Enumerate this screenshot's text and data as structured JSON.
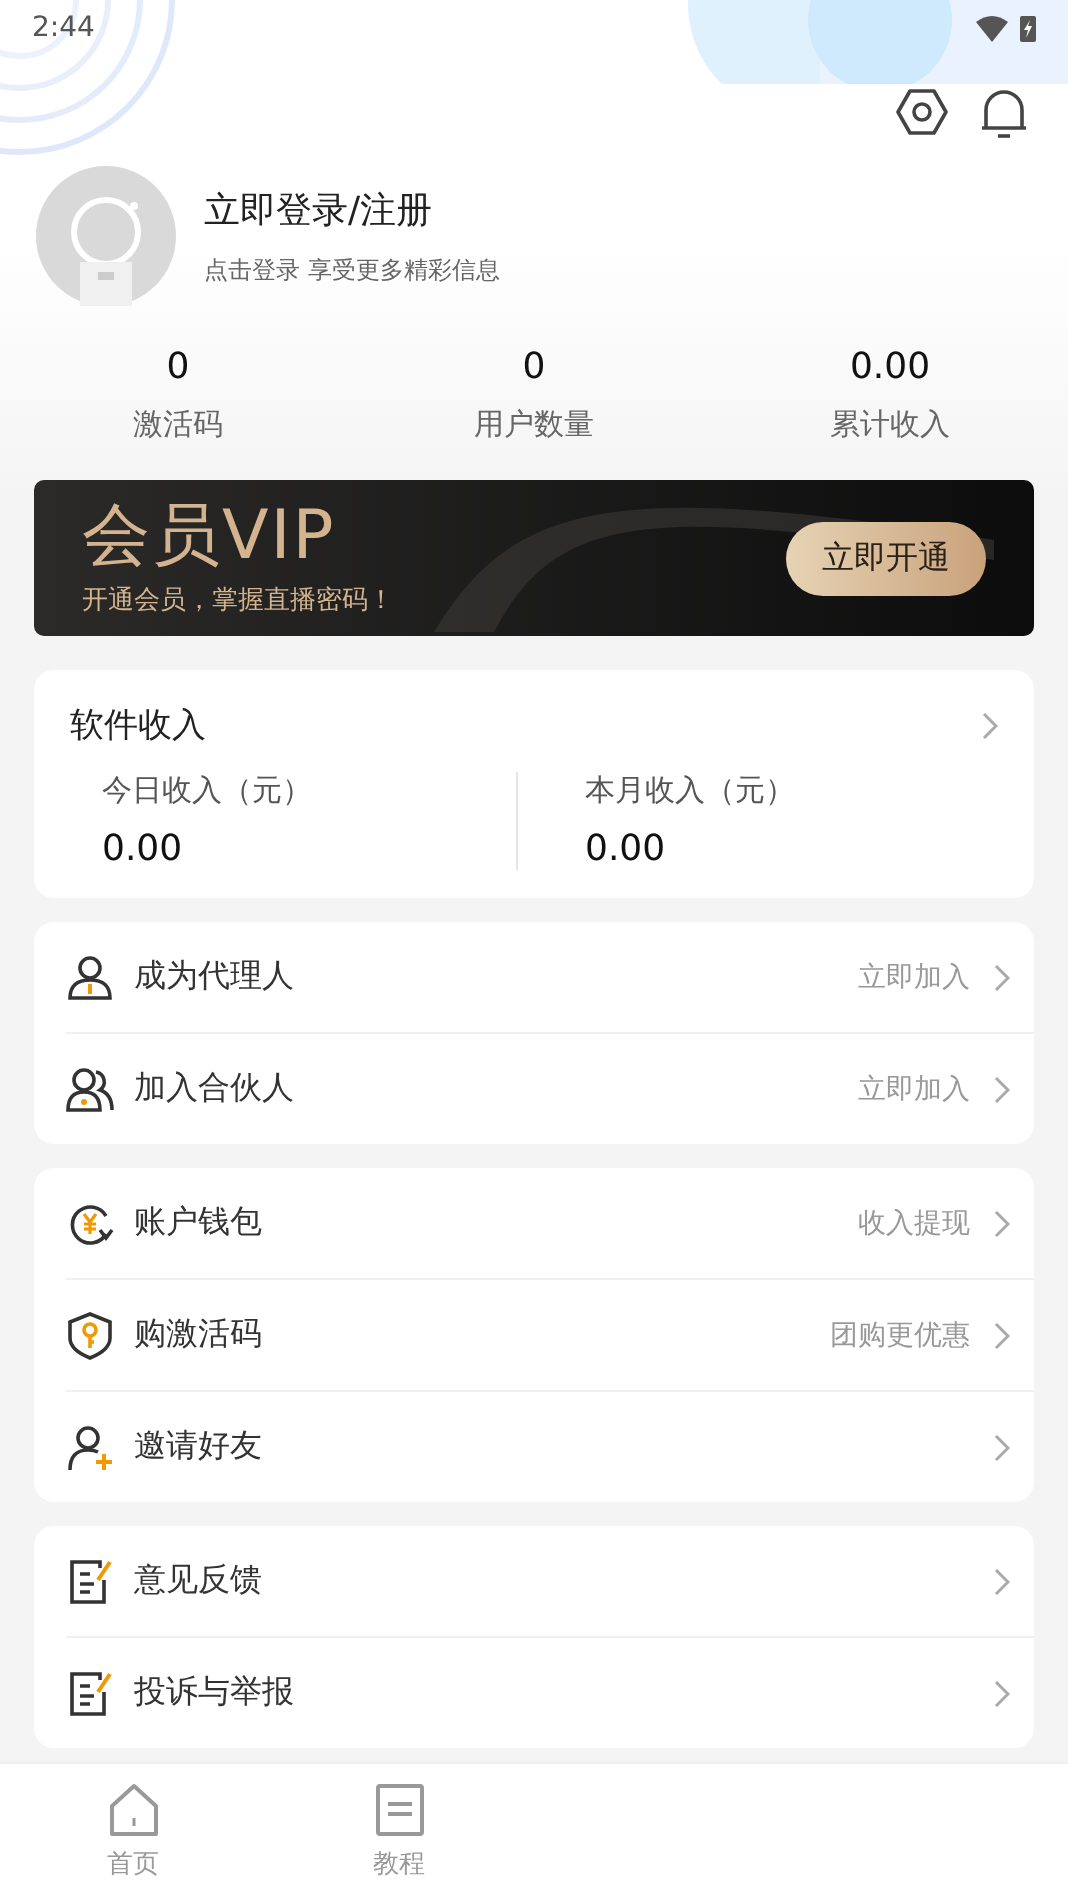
{
  "status_bar": {
    "time": "2:44"
  },
  "profile": {
    "title": "立即登录/注册",
    "subtitle": "点击登录 享受更多精彩信息"
  },
  "stats": [
    {
      "value": "0",
      "label": "激活码"
    },
    {
      "value": "0",
      "label": "用户数量"
    },
    {
      "value": "0.00",
      "label": "累计收入"
    }
  ],
  "vip_banner": {
    "title": "会员VIP",
    "subtitle": "开通会员，掌握直播密码！",
    "button": "立即开通"
  },
  "income": {
    "title": "软件收入",
    "items": [
      {
        "label": "今日收入（元）",
        "value": "0.00"
      },
      {
        "label": "本月收入（元）",
        "value": "0.00"
      }
    ]
  },
  "menu_groups": [
    [
      {
        "kind": "agent",
        "label": "成为代理人",
        "hint": "立即加入"
      },
      {
        "kind": "partner",
        "label": "加入合伙人",
        "hint": "立即加入"
      }
    ],
    [
      {
        "kind": "wallet",
        "label": "账户钱包",
        "hint": "收入提现"
      },
      {
        "kind": "code",
        "label": "购激活码",
        "hint": "团购更优惠"
      },
      {
        "kind": "invite",
        "label": "邀请好友"
      }
    ],
    [
      {
        "kind": "feedback",
        "label": "意见反馈"
      },
      {
        "kind": "report",
        "label": "投诉与举报"
      }
    ]
  ],
  "tab_bar": [
    {
      "kind": "home",
      "label": "首页",
      "selected": false
    },
    {
      "kind": "doc",
      "label": "教程",
      "selected": false
    }
  ]
}
